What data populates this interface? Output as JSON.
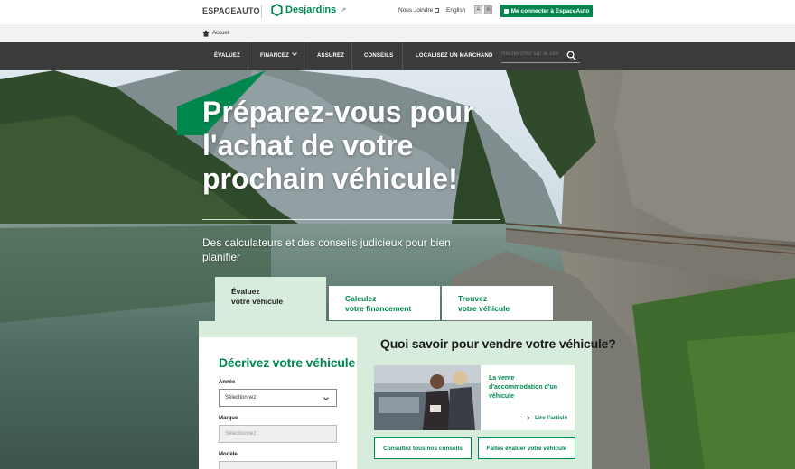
{
  "topbar": {
    "site_name": "ESPACEAUTO",
    "brand_name": "Desjardins",
    "contact_label": "Nous Joindre",
    "language_label": "English",
    "font_small_label": "A",
    "font_large_label": "A",
    "connect_label": "Me connecter à EspaceAuto"
  },
  "breadcrumb": {
    "home_label": "Accueil"
  },
  "nav": {
    "items": [
      {
        "label": "ÉVALUEZ"
      },
      {
        "label": "FINANCEZ"
      },
      {
        "label": "ASSUREZ"
      },
      {
        "label": "CONSEILS"
      },
      {
        "label": "LOCALISEZ UN MARCHAND"
      }
    ],
    "search_placeholder": "Rechercher sur le site"
  },
  "hero": {
    "title": "Préparez-vous pour l'achat de votre prochain véhicule!",
    "subtitle": "Des calculateurs et des conseils judicieux pour bien planifier"
  },
  "tabs": [
    {
      "line1": "Évaluez",
      "line2": "votre véhicule",
      "active": true
    },
    {
      "line1": "Calculez",
      "line2": "votre financement",
      "active": false
    },
    {
      "line1": "Trouvez",
      "line2": "votre véhicule",
      "active": false
    }
  ],
  "form": {
    "title": "Décrivez votre véhicule",
    "year_label": "Année",
    "year_value": "Sélectionnez",
    "make_label": "Marque",
    "make_value": "Sélectionnez",
    "model_label": "Modèle"
  },
  "sell": {
    "title": "Quoi savoir pour vendre votre véhicule?",
    "article_title": "La vente d'accommodation d'un véhicule",
    "read_label": "Lire l'article",
    "cta_advice": "Consultez tous nos conseils",
    "cta_evaluate": "Faites évaluer votre véhicule"
  },
  "colors": {
    "brand_green": "#00874e",
    "panel_green": "#d8ecdc",
    "nav_dark": "#3b3b3b"
  }
}
